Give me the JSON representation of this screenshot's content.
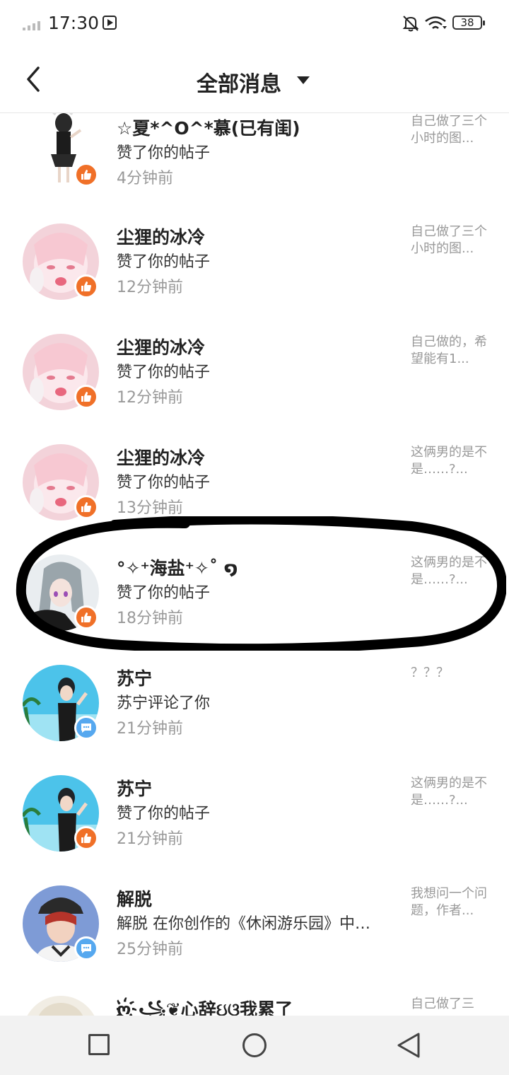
{
  "status_bar": {
    "time": "17:30",
    "battery": "38"
  },
  "header": {
    "title": "全部消息"
  },
  "messages": [
    {
      "name": "☆夏*^O^*慕(已有闺)",
      "action": "赞了你的帖子",
      "time": "4分钟前",
      "preview": "自己做了三个小时的图...",
      "badge": "like"
    },
    {
      "name": "尘狸的冰冷",
      "action": "赞了你的帖子",
      "time": "12分钟前",
      "preview": "自己做了三个小时的图...",
      "badge": "like"
    },
    {
      "name": "尘狸的冰冷",
      "action": "赞了你的帖子",
      "time": "12分钟前",
      "preview": "自己做的，希望能有1...",
      "badge": "like"
    },
    {
      "name": "尘狸的冰冷",
      "action": "赞了你的帖子",
      "time": "13分钟前",
      "preview": "这俩男的是不是……?...",
      "badge": "like"
    },
    {
      "name": "°✧⁺海盐⁺✧˚ ໑ ",
      "action": "赞了你的帖子",
      "time": "18分钟前",
      "preview": "这俩男的是不是……?...",
      "badge": "like"
    },
    {
      "name": "苏宁",
      "action": "苏宁评论了你",
      "time": "21分钟前",
      "preview": "？？？",
      "badge": "comment"
    },
    {
      "name": "苏宁",
      "action": "赞了你的帖子",
      "time": "21分钟前",
      "preview": "这俩男的是不是……?...",
      "badge": "like"
    },
    {
      "name": "解脱",
      "action": "解脱 在你创作的《休闲游乐园》中…",
      "time": "25分钟前",
      "preview": "我想问一个问题，作者...",
      "badge": "comment"
    },
    {
      "name": "ღ҉꧁❦心辞ઇଓ我累了",
      "action": "",
      "time": "",
      "preview": "自己做了三",
      "badge": ""
    }
  ],
  "colors": {
    "like_badge": "#f07028",
    "comment_badge": "#56a8ef",
    "secondary_text": "#999999"
  }
}
